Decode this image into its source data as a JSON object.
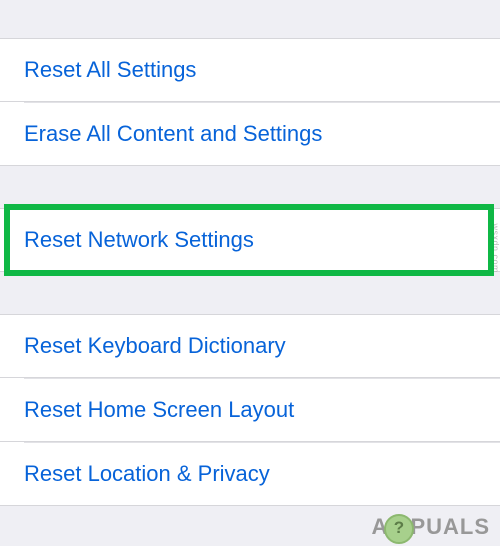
{
  "groups": {
    "first": [
      {
        "label": "Reset All Settings"
      },
      {
        "label": "Erase All Content and Settings"
      }
    ],
    "network": [
      {
        "label": "Reset Network Settings"
      }
    ],
    "third": [
      {
        "label": "Reset Keyboard Dictionary"
      },
      {
        "label": "Reset Home Screen Layout"
      },
      {
        "label": "Reset Location & Privacy"
      }
    ]
  },
  "watermark": {
    "prefix": "A",
    "suffix": "PUALS"
  },
  "attribution": "wsxdn.com"
}
